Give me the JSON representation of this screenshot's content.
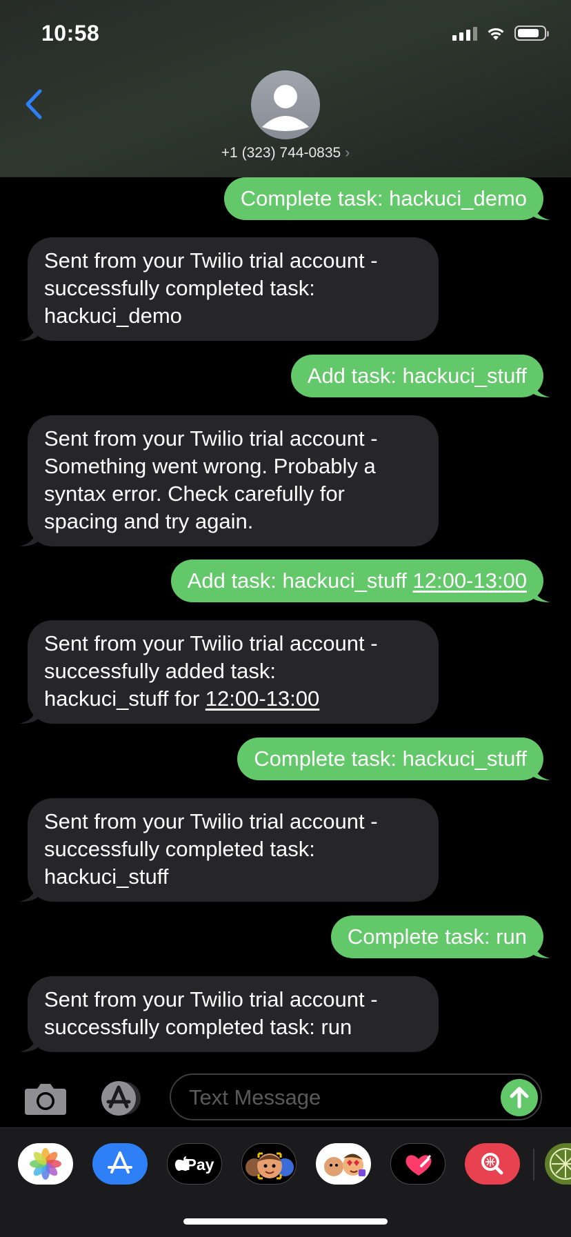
{
  "status_bar": {
    "time": "10:58"
  },
  "header": {
    "contact_number": "+1 (323) 744-0835",
    "chevron": "›"
  },
  "messages": [
    {
      "direction": "out",
      "text": "Complete task: hackuci_demo"
    },
    {
      "direction": "in",
      "text": "Sent from your Twilio trial account -\nsuccessfully completed task:\nhackuci_demo"
    },
    {
      "direction": "out",
      "text": "Add task: hackuci_stuff"
    },
    {
      "direction": "in",
      "text": "Sent from your Twilio trial account -\nSomething went wrong. Probably a\nsyntax error. Check carefully for\nspacing and try again."
    },
    {
      "direction": "out",
      "text": "Add task: hackuci_stuff ",
      "link": "12:00-13:00"
    },
    {
      "direction": "in",
      "text": "Sent from your Twilio trial account -\nsuccessfully added task:\nhackuci_stuff for ",
      "link": "12:00-13:00"
    },
    {
      "direction": "out",
      "text": "Complete task: hackuci_stuff"
    },
    {
      "direction": "in",
      "text": "Sent from your Twilio trial account -\nsuccessfully completed task:\nhackuci_stuff"
    },
    {
      "direction": "out",
      "text": "Complete task: run"
    },
    {
      "direction": "in",
      "text": "Sent from your Twilio trial account -\nsuccessfully completed task: run"
    }
  ],
  "composer": {
    "placeholder": "Text Message"
  },
  "app_drawer": {
    "apple_pay_label": "Pay"
  },
  "colors": {
    "outgoing_bubble": "#63c869",
    "incoming_bubble": "#262628",
    "accent_blue": "#2f7ff6"
  },
  "icons": [
    "back-chevron-icon",
    "contact-avatar-icon",
    "camera-icon",
    "app-store-icon",
    "send-arrow-icon",
    "photos-icon",
    "apple-pay-icon",
    "memoji-icon",
    "digital-touch-icon",
    "search-images-icon"
  ]
}
